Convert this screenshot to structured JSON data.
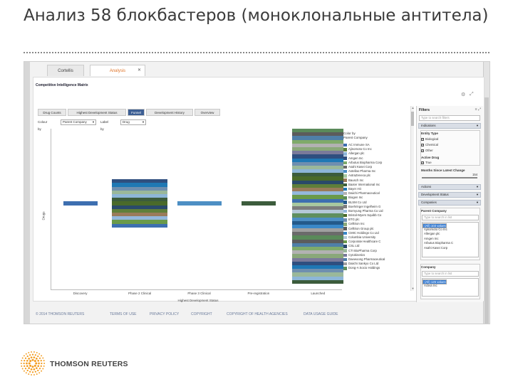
{
  "slide": {
    "title": "Анализ 58 блокбастеров (моноклональные антитела)",
    "company_name": "THOMSON REUTERS"
  },
  "app": {
    "tabs": [
      {
        "label": "Cortellis",
        "active": false
      },
      {
        "label": "Analysis",
        "active": true
      }
    ],
    "tab_close": "✕",
    "section_title": "Competitive Intelligence Matrix",
    "subtabs": [
      {
        "label": "Drug Counts",
        "active": false
      },
      {
        "label": "Highest Development Status",
        "active": false
      },
      {
        "label": "Funnel",
        "active": true
      },
      {
        "label": "Development History",
        "active": false
      },
      {
        "label": "Overview",
        "active": false
      }
    ],
    "controls": {
      "colour_by_label": "Colour by",
      "colour_by_value": "Parent Company",
      "label_by_label": "Label by",
      "label_by_value": "Drug"
    },
    "footer": [
      "© 2014 THOMSON REUTERS",
      "TERMS OF USE",
      "PRIVACY POLICY",
      "COPYRIGHT",
      "COPYRIGHT OF HEALTH AGENCIES",
      "DATA USAGE GUIDE"
    ]
  },
  "chart_data": {
    "type": "bar",
    "stacked": true,
    "ylabel": "Drugs",
    "xlabel": "Highest Development Status",
    "categories": [
      "Discovery",
      "Phase 2 Clinical",
      "Phase 3 Clinical",
      "Pre-registration",
      "Launched"
    ],
    "stack_counts": [
      1,
      13,
      1,
      1,
      42
    ],
    "legend_title": "Color by",
    "legend_subtitle": "Parent Company",
    "legend": [
      {
        "name": "AC Immune SA",
        "color": "#3d6fb0"
      },
      {
        "name": "Ajinomoto Co Inc",
        "color": "#5f7f3a"
      },
      {
        "name": "Allergan plc",
        "color": "#8db6d8"
      },
      {
        "name": "Amgen Inc",
        "color": "#2f4f7f"
      },
      {
        "name": "Arbutus Biopharma Corp",
        "color": "#7faa6a"
      },
      {
        "name": "Asahi Kasei Corp",
        "color": "#6b6b6b"
      },
      {
        "name": "Astellas Pharma Inc",
        "color": "#4d8fc4"
      },
      {
        "name": "AstraZeneca plc",
        "color": "#a8c8a0"
      },
      {
        "name": "Bausch Inc",
        "color": "#9a7b5a"
      },
      {
        "name": "Baxter International Inc",
        "color": "#3c5c3c"
      },
      {
        "name": "Bayer AG",
        "color": "#1f78b4"
      },
      {
        "name": "Daiichi Pharmaceutical",
        "color": "#b2b2b2"
      },
      {
        "name": "Biogen Inc",
        "color": "#5a8a5a"
      },
      {
        "name": "BLSM Co Ltd",
        "color": "#245a8a"
      },
      {
        "name": "Boehringer Ingelheim G",
        "color": "#7d7d7d"
      },
      {
        "name": "Bornyung Pharma Co Ltd",
        "color": "#94b8dc"
      },
      {
        "name": "Bristol-Myers Squibb Co",
        "color": "#4a6a2a"
      },
      {
        "name": "BTG plc",
        "color": "#6f8faf"
      },
      {
        "name": "Celltrion Inc",
        "color": "#8aa87a"
      },
      {
        "name": "Celltrion Group plc",
        "color": "#5c5c5c"
      },
      {
        "name": "CMIC Holdings Co Ltd",
        "color": "#3a88c8"
      },
      {
        "name": "Columbia University",
        "color": "#b4c8d8"
      },
      {
        "name": "Corporate Healthcare C",
        "color": "#6a9a4a"
      },
      {
        "name": "CSL Ltd",
        "color": "#2a4a6a"
      },
      {
        "name": "CTI BioPharma Corp",
        "color": "#9ab89a"
      },
      {
        "name": "Cytokinetics",
        "color": "#7a7a9a"
      },
      {
        "name": "Daewoong Pharmaceutical",
        "color": "#4f7fa8"
      },
      {
        "name": "Daiichi Sankyo Co Ltd",
        "color": "#a0a0a0"
      },
      {
        "name": "Dong-A Socio Holdings",
        "color": "#5f8f5f"
      }
    ],
    "grid": false,
    "legend_position": "right"
  },
  "filters": {
    "title": "Filters",
    "search_placeholder": "Type to search filters",
    "indications_label": "Indications",
    "entity_type_label": "Entity Type",
    "entity_types": [
      {
        "label": "Biological",
        "checked": true
      },
      {
        "label": "Chemical",
        "checked": true
      },
      {
        "label": "Other",
        "checked": true
      }
    ],
    "active_drug_label": "Active Drug",
    "active_drug_option": {
      "label": "True",
      "checked": true
    },
    "months_label": "Months Since Latest Change",
    "months_value": "154",
    "actions_label": "Actions",
    "dev_status_label": "Development Status",
    "companies_label": "Companies",
    "parent_company_label": "Parent Company",
    "parent_search_placeholder": "Type to search in list",
    "parent_company_items": [
      {
        "label": "(All) 103 values",
        "selected": true
      },
      {
        "label": "AC Immune SA",
        "selected": false
      },
      {
        "label": "Ajinomoto Co Inc",
        "selected": false
      },
      {
        "label": "Allergan plc",
        "selected": false
      },
      {
        "label": "Amgen Inc",
        "selected": false
      },
      {
        "label": "Arbutus Biopharma C",
        "selected": false
      },
      {
        "label": "Asahi Kasei Corp",
        "selected": false
      }
    ],
    "company_label": "Company",
    "company_search_placeholder": "Type to search in list",
    "company_items": [
      {
        "label": "(All) 125 values",
        "selected": true
      },
      {
        "label": "AC Immune SA",
        "selected": false
      },
      {
        "label": "Activa Inc",
        "selected": false
      }
    ]
  }
}
